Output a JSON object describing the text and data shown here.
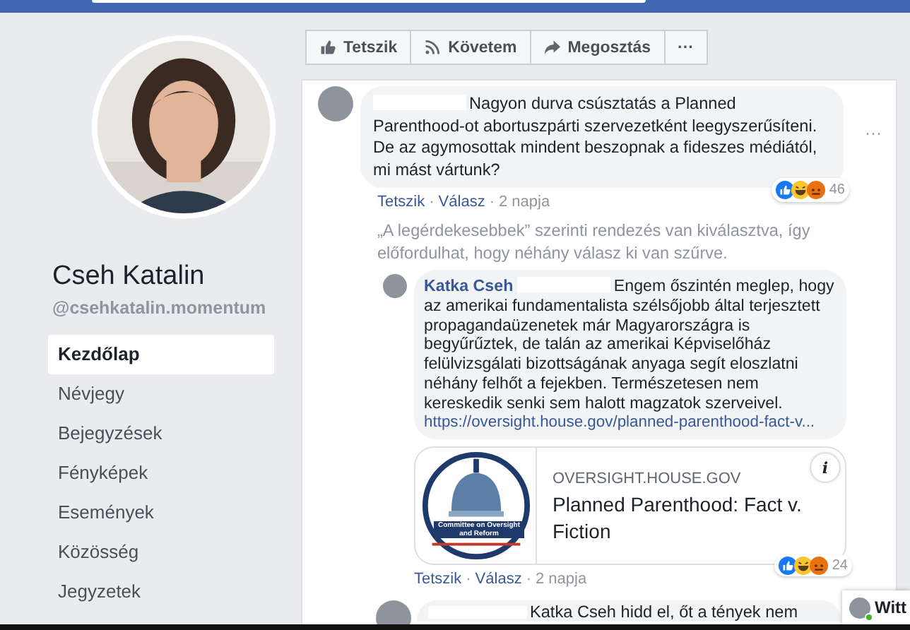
{
  "profile": {
    "name": "Cseh Katalin",
    "handle": "@csehkatalin.momentum"
  },
  "nav": [
    {
      "label": "Kezdőlap",
      "selected": true
    },
    {
      "label": "Névjegy",
      "selected": false
    },
    {
      "label": "Bejegyzések",
      "selected": false
    },
    {
      "label": "Fényképek",
      "selected": false
    },
    {
      "label": "Események",
      "selected": false
    },
    {
      "label": "Közösség",
      "selected": false
    },
    {
      "label": "Jegyzetek",
      "selected": false
    }
  ],
  "page_actions": [
    {
      "kind": "like",
      "label": "Tetszik"
    },
    {
      "kind": "follow",
      "label": "Követem"
    },
    {
      "kind": "share",
      "label": "Megosztás"
    },
    {
      "kind": "more",
      "label": "···"
    }
  ],
  "comment": {
    "redacted": true,
    "text": "Nagyon durva csúsztatás a Planned Parenthood-ot abortuszpárti szervezetként leegyszerűsíteni. De az agymosottak mindent beszopnak a fideszes médiától, mi mást vártunk?",
    "menu": "···",
    "reactions": [
      {
        "kind": "like"
      },
      {
        "kind": "haha"
      },
      {
        "kind": "angry"
      }
    ],
    "reaction_count": "46",
    "actions": [
      "Tetszik",
      "Válasz"
    ],
    "separator": "·",
    "time": "2 napja"
  },
  "sort_notice": "„A legérdekesebbek” szerinti rendezés van kiválasztva, így előfordulhat, hogy néhány válasz ki van szűrve.",
  "reply": {
    "author": "Katka Cseh",
    "redacted": true,
    "text": "Engem őszintén meglep, hogy az amerikai fundamentalista szélsőjobb által terjesztett propagandaüzenetek már Magyarországra is begyűrűztek, de talán az amerikai Képviselőház felülvizsgálati bizottságának anyaga segít eloszlatni néhány felhőt a fejekben. Természetesen nem kereskedik senki sem halott magzatok szerveivel.",
    "link": "https://oversight.house.gov/planned-parenthood-fact-v...",
    "preview": {
      "logo_text": "Committee on Oversight and Reform",
      "domain": "OVERSIGHT.HOUSE.GOV",
      "title": "Planned Parenthood: Fact v. Fiction",
      "info": "i"
    },
    "reactions": [
      {
        "kind": "like"
      },
      {
        "kind": "haha"
      },
      {
        "kind": "angry"
      }
    ],
    "reaction_count": "24",
    "actions": [
      "Tetszik",
      "Válasz"
    ],
    "separator": "·",
    "time": "2 napja"
  },
  "next_comment": {
    "redacted": true,
    "text": "Katka Cseh hidd el, őt a tények nem"
  },
  "chat": {
    "name": "Witt",
    "online": true
  }
}
